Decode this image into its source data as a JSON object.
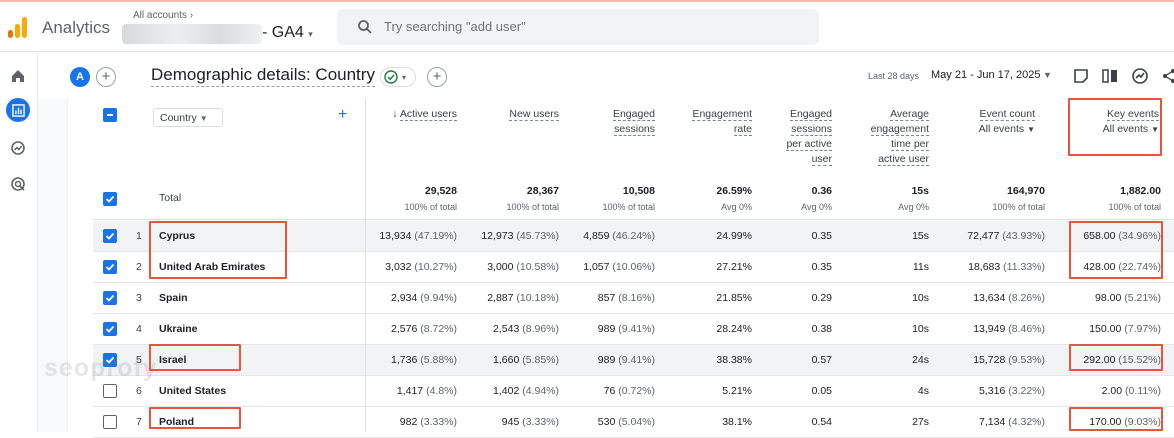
{
  "header": {
    "app_title": "Analytics",
    "account_crumb": "All accounts",
    "property_name": "- GA4",
    "search_placeholder": "Try searching \"add user\""
  },
  "titlebar": {
    "avatar_letter": "A",
    "page_title": "Demographic details: Country",
    "date_label": "Last 28 days",
    "date_range": "May 21 - Jun 17, 2025"
  },
  "table": {
    "dimension_label": "Country",
    "columns": {
      "active_users": "Active users",
      "new_users": "New users",
      "engaged_sessions": [
        "Engaged",
        "sessions"
      ],
      "engagement_rate": [
        "Engagement",
        "rate"
      ],
      "engaged_per_user": [
        "Engaged",
        "sessions",
        "per active",
        "user"
      ],
      "avg_time": [
        "Average",
        "engagement",
        "time per",
        "active user"
      ],
      "event_count": "Event count",
      "event_count_filter": "All events",
      "key_events": "Key events",
      "key_events_filter": "All events"
    },
    "total": {
      "label": "Total",
      "active_users": "29,528",
      "active_users_sub": "100% of total",
      "new_users": "28,367",
      "new_users_sub": "100% of total",
      "engaged_sessions": "10,508",
      "engaged_sessions_sub": "100% of total",
      "engagement_rate": "26.59%",
      "engagement_rate_sub": "Avg 0%",
      "engaged_per_user": "0.36",
      "engaged_per_user_sub": "Avg 0%",
      "avg_time": "15s",
      "avg_time_sub": "Avg 0%",
      "event_count": "164,970",
      "event_count_sub": "100% of total",
      "key_events": "1,882.00",
      "key_events_sub": "100% of total"
    },
    "rows": [
      {
        "rank": "1",
        "country": "Cyprus",
        "checked": true,
        "au": "13,934",
        "au_p": "(47.19%)",
        "nu": "12,973",
        "nu_p": "(45.73%)",
        "es": "4,859",
        "es_p": "(46.24%)",
        "er": "24.99%",
        "epu": "0.35",
        "at": "15s",
        "ec": "72,477",
        "ec_p": "(43.93%)",
        "ke": "658.00",
        "ke_p": "(34.96%)"
      },
      {
        "rank": "2",
        "country": "United Arab Emirates",
        "checked": true,
        "au": "3,032",
        "au_p": "(10.27%)",
        "nu": "3,000",
        "nu_p": "(10.58%)",
        "es": "1,057",
        "es_p": "(10.06%)",
        "er": "27.21%",
        "epu": "0.35",
        "at": "11s",
        "ec": "18,683",
        "ec_p": "(11.33%)",
        "ke": "428.00",
        "ke_p": "(22.74%)"
      },
      {
        "rank": "3",
        "country": "Spain",
        "checked": true,
        "au": "2,934",
        "au_p": "(9.94%)",
        "nu": "2,887",
        "nu_p": "(10.18%)",
        "es": "857",
        "es_p": "(8.16%)",
        "er": "21.85%",
        "epu": "0.29",
        "at": "10s",
        "ec": "13,634",
        "ec_p": "(8.26%)",
        "ke": "98.00",
        "ke_p": "(5.21%)"
      },
      {
        "rank": "4",
        "country": "Ukraine",
        "checked": true,
        "au": "2,576",
        "au_p": "(8.72%)",
        "nu": "2,543",
        "nu_p": "(8.96%)",
        "es": "989",
        "es_p": "(9.41%)",
        "er": "28.24%",
        "epu": "0.38",
        "at": "10s",
        "ec": "13,949",
        "ec_p": "(8.46%)",
        "ke": "150.00",
        "ke_p": "(7.97%)"
      },
      {
        "rank": "5",
        "country": "Israel",
        "checked": true,
        "au": "1,736",
        "au_p": "(5.88%)",
        "nu": "1,660",
        "nu_p": "(5.85%)",
        "es": "989",
        "es_p": "(9.41%)",
        "er": "38.38%",
        "epu": "0.57",
        "at": "24s",
        "ec": "15,728",
        "ec_p": "(9.53%)",
        "ke": "292.00",
        "ke_p": "(15.52%)"
      },
      {
        "rank": "6",
        "country": "United States",
        "checked": false,
        "au": "1,417",
        "au_p": "(4.8%)",
        "nu": "1,402",
        "nu_p": "(4.94%)",
        "es": "76",
        "es_p": "(0.72%)",
        "er": "5.21%",
        "epu": "0.05",
        "at": "4s",
        "ec": "5,316",
        "ec_p": "(3.22%)",
        "ke": "2.00",
        "ke_p": "(0.11%)"
      },
      {
        "rank": "7",
        "country": "Poland",
        "checked": false,
        "au": "982",
        "au_p": "(3.33%)",
        "nu": "945",
        "nu_p": "(3.33%)",
        "es": "530",
        "es_p": "(5.04%)",
        "er": "38.1%",
        "epu": "0.54",
        "at": "27s",
        "ec": "7,134",
        "ec_p": "(4.32%)",
        "ke": "170.00",
        "ke_p": "(9.03%)"
      }
    ]
  },
  "watermark": "seoprofy",
  "colors": {
    "accent": "#1a73e8",
    "highlight": "#e8553e",
    "logo_orange": "#f9ab00",
    "logo_dark": "#e37400"
  }
}
